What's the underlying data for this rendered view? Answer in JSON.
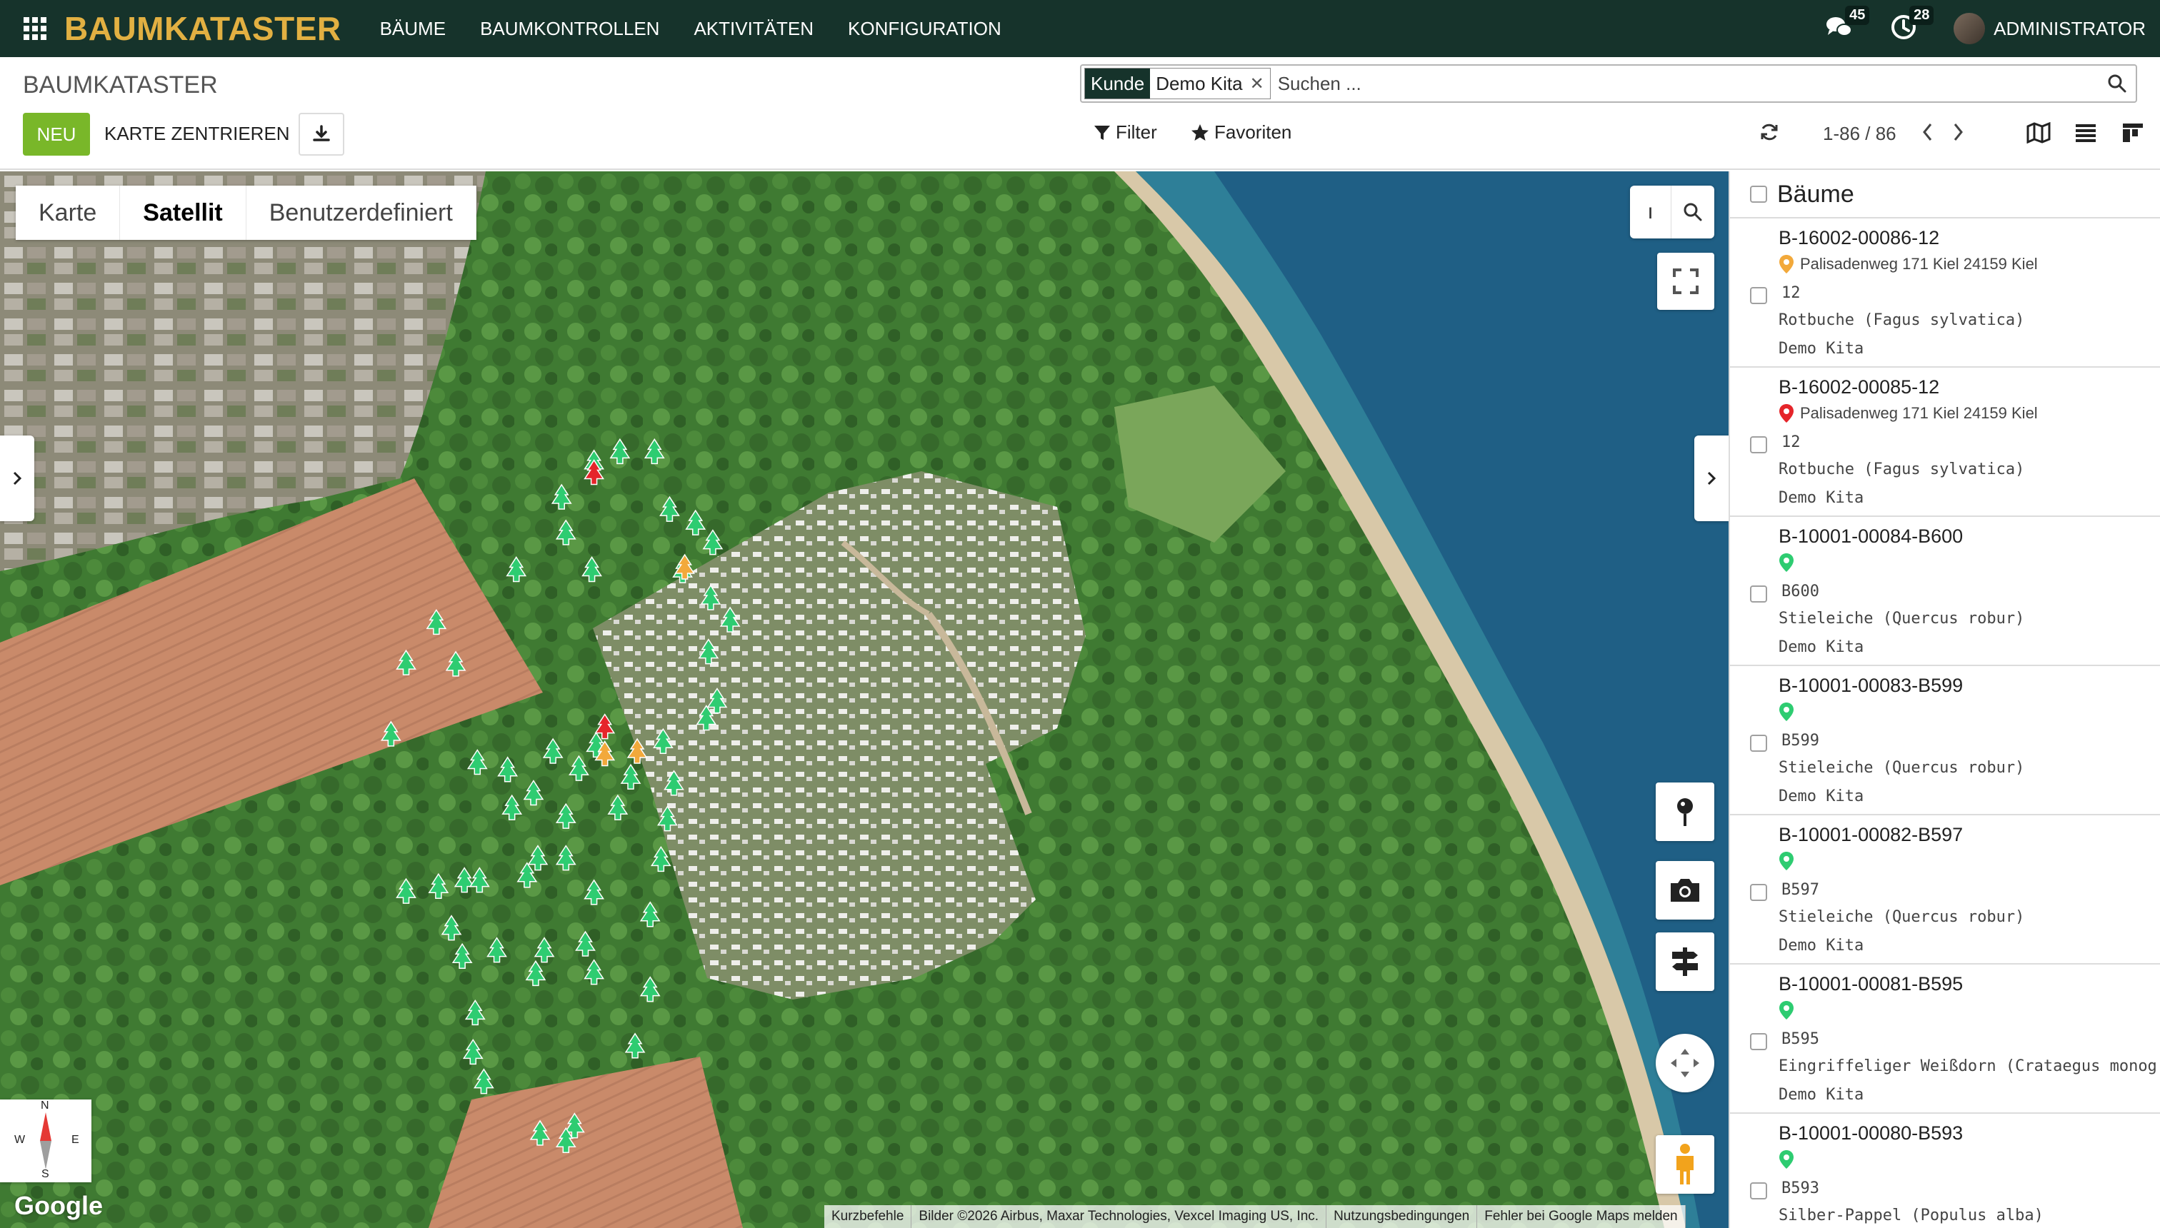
{
  "navbar": {
    "brand": "BAUMKATASTER",
    "menu": [
      "BÄUME",
      "BAUMKONTROLLEN",
      "AKTIVITÄTEN",
      "KONFIGURATION"
    ],
    "messages_count": "45",
    "activities_count": "28",
    "user": "ADMINISTRATOR"
  },
  "control_panel": {
    "breadcrumb": "BAUMKATASTER",
    "new_label": "NEU",
    "center_label": "KARTE ZENTRIEREN",
    "filter_label": "Filter",
    "favorites_label": "Favoriten",
    "pager": "1-86 / 86"
  },
  "search": {
    "facet_label": "Kunde",
    "facet_value": "Demo Kita",
    "placeholder": "Suchen ..."
  },
  "map": {
    "types": [
      "Karte",
      "Satellit",
      "Benutzerdefiniert"
    ],
    "active_type": "Satellit",
    "compass": {
      "n": "N",
      "s": "S",
      "e": "E",
      "w": "W"
    },
    "logo": "Google",
    "attribution": [
      "Kurzbefehle",
      "Bilder ©2026 Airbus, Maxar Technologies, Vexcel Imaging US, Inc.",
      "Nutzungsbedingungen",
      "Fehler bei Google Maps melden"
    ],
    "markers": [
      {
        "lon": 0.287,
        "lat": 0.231,
        "status": "ok"
      },
      {
        "lon": 0.303,
        "lat": 0.231,
        "status": "ok"
      },
      {
        "lon": 0.31,
        "lat": 0.278,
        "status": "ok"
      },
      {
        "lon": 0.322,
        "lat": 0.289,
        "status": "ok"
      },
      {
        "lon": 0.33,
        "lat": 0.305,
        "status": "ok"
      },
      {
        "lon": 0.26,
        "lat": 0.268,
        "status": "ok"
      },
      {
        "lon": 0.275,
        "lat": 0.24,
        "status": "ok"
      },
      {
        "lon": 0.239,
        "lat": 0.327,
        "status": "ok"
      },
      {
        "lon": 0.262,
        "lat": 0.297,
        "status": "ok"
      },
      {
        "lon": 0.274,
        "lat": 0.327,
        "status": "ok"
      },
      {
        "lon": 0.316,
        "lat": 0.328,
        "status": "ok"
      },
      {
        "lon": 0.329,
        "lat": 0.35,
        "status": "ok"
      },
      {
        "lon": 0.338,
        "lat": 0.368,
        "status": "ok"
      },
      {
        "lon": 0.328,
        "lat": 0.394,
        "status": "ok"
      },
      {
        "lon": 0.332,
        "lat": 0.434,
        "status": "ok"
      },
      {
        "lon": 0.327,
        "lat": 0.448,
        "status": "ok"
      },
      {
        "lon": 0.202,
        "lat": 0.37,
        "status": "ok"
      },
      {
        "lon": 0.188,
        "lat": 0.403,
        "status": "ok"
      },
      {
        "lon": 0.211,
        "lat": 0.404,
        "status": "ok"
      },
      {
        "lon": 0.181,
        "lat": 0.461,
        "status": "ok"
      },
      {
        "lon": 0.221,
        "lat": 0.484,
        "status": "ok"
      },
      {
        "lon": 0.237,
        "lat": 0.521,
        "status": "ok"
      },
      {
        "lon": 0.247,
        "lat": 0.509,
        "status": "ok"
      },
      {
        "lon": 0.256,
        "lat": 0.475,
        "status": "ok"
      },
      {
        "lon": 0.268,
        "lat": 0.489,
        "status": "ok"
      },
      {
        "lon": 0.276,
        "lat": 0.47,
        "status": "ok"
      },
      {
        "lon": 0.292,
        "lat": 0.496,
        "status": "ok"
      },
      {
        "lon": 0.307,
        "lat": 0.467,
        "status": "ok"
      },
      {
        "lon": 0.312,
        "lat": 0.501,
        "status": "ok"
      },
      {
        "lon": 0.203,
        "lat": 0.585,
        "status": "ok"
      },
      {
        "lon": 0.215,
        "lat": 0.58,
        "status": "ok"
      },
      {
        "lon": 0.222,
        "lat": 0.58,
        "status": "ok"
      },
      {
        "lon": 0.209,
        "lat": 0.619,
        "status": "ok"
      },
      {
        "lon": 0.214,
        "lat": 0.642,
        "status": "ok"
      },
      {
        "lon": 0.23,
        "lat": 0.637,
        "status": "ok"
      },
      {
        "lon": 0.244,
        "lat": 0.576,
        "status": "ok"
      },
      {
        "lon": 0.249,
        "lat": 0.562,
        "status": "ok"
      },
      {
        "lon": 0.262,
        "lat": 0.562,
        "status": "ok"
      },
      {
        "lon": 0.271,
        "lat": 0.632,
        "status": "ok"
      },
      {
        "lon": 0.275,
        "lat": 0.59,
        "status": "ok"
      },
      {
        "lon": 0.252,
        "lat": 0.637,
        "status": "ok"
      },
      {
        "lon": 0.248,
        "lat": 0.656,
        "status": "ok"
      },
      {
        "lon": 0.22,
        "lat": 0.688,
        "status": "ok"
      },
      {
        "lon": 0.219,
        "lat": 0.72,
        "status": "ok"
      },
      {
        "lon": 0.224,
        "lat": 0.744,
        "status": "ok"
      },
      {
        "lon": 0.25,
        "lat": 0.786,
        "status": "ok"
      },
      {
        "lon": 0.266,
        "lat": 0.78,
        "status": "ok"
      },
      {
        "lon": 0.262,
        "lat": 0.792,
        "status": "ok"
      },
      {
        "lon": 0.275,
        "lat": 0.655,
        "status": "ok"
      },
      {
        "lon": 0.301,
        "lat": 0.608,
        "status": "ok"
      },
      {
        "lon": 0.301,
        "lat": 0.669,
        "status": "ok"
      },
      {
        "lon": 0.294,
        "lat": 0.715,
        "status": "ok"
      },
      {
        "lon": 0.306,
        "lat": 0.563,
        "status": "ok"
      },
      {
        "lon": 0.309,
        "lat": 0.53,
        "status": "ok"
      },
      {
        "lon": 0.188,
        "lat": 0.589,
        "status": "ok"
      },
      {
        "lon": 0.235,
        "lat": 0.49,
        "status": "ok"
      },
      {
        "lon": 0.262,
        "lat": 0.528,
        "status": "ok"
      },
      {
        "lon": 0.286,
        "lat": 0.521,
        "status": "ok"
      },
      {
        "lon": 0.275,
        "lat": 0.248,
        "status": "alert"
      },
      {
        "lon": 0.28,
        "lat": 0.455,
        "status": "alert"
      },
      {
        "lon": 0.28,
        "lat": 0.477,
        "status": "warning"
      },
      {
        "lon": 0.295,
        "lat": 0.475,
        "status": "warning"
      },
      {
        "lon": 0.317,
        "lat": 0.325,
        "status": "warning"
      }
    ]
  },
  "sidebar": {
    "title": "Bäume",
    "items": [
      {
        "ref": "B-16002-00086-12",
        "address": "Palisadenweg 171 Kiel 24159 Kiel",
        "number": "12",
        "species": "Rotbuche (Fagus sylvatica)",
        "customer": "Demo Kita",
        "marker_color": "#f2a93b"
      },
      {
        "ref": "B-16002-00085-12",
        "address": "Palisadenweg 171 Kiel 24159 Kiel",
        "number": "12",
        "species": "Rotbuche (Fagus sylvatica)",
        "customer": "Demo Kita",
        "marker_color": "#e5252a"
      },
      {
        "ref": "B-10001-00084-B600",
        "address": "",
        "number": "B600",
        "species": "Stieleiche (Quercus robur)",
        "customer": "Demo Kita",
        "marker_color": "#2ecc71"
      },
      {
        "ref": "B-10001-00083-B599",
        "address": "",
        "number": "B599",
        "species": "Stieleiche (Quercus robur)",
        "customer": "Demo Kita",
        "marker_color": "#2ecc71"
      },
      {
        "ref": "B-10001-00082-B597",
        "address": "",
        "number": "B597",
        "species": "Stieleiche (Quercus robur)",
        "customer": "Demo Kita",
        "marker_color": "#2ecc71"
      },
      {
        "ref": "B-10001-00081-B595",
        "address": "",
        "number": "B595",
        "species": "Eingriffeliger Weißdorn (Crataegus monog",
        "customer": "Demo Kita",
        "marker_color": "#2ecc71"
      },
      {
        "ref": "B-10001-00080-B593",
        "address": "",
        "number": "B593",
        "species": "Silber-Pappel (Populus alba)",
        "customer": "",
        "marker_color": "#2ecc71"
      }
    ]
  },
  "colors": {
    "navbar": "#16332b",
    "brand": "#e2b042",
    "primary_button": "#79b729",
    "marker_ok": "#2ecc71",
    "marker_warning": "#f2a93b",
    "marker_alert": "#e5252a"
  }
}
